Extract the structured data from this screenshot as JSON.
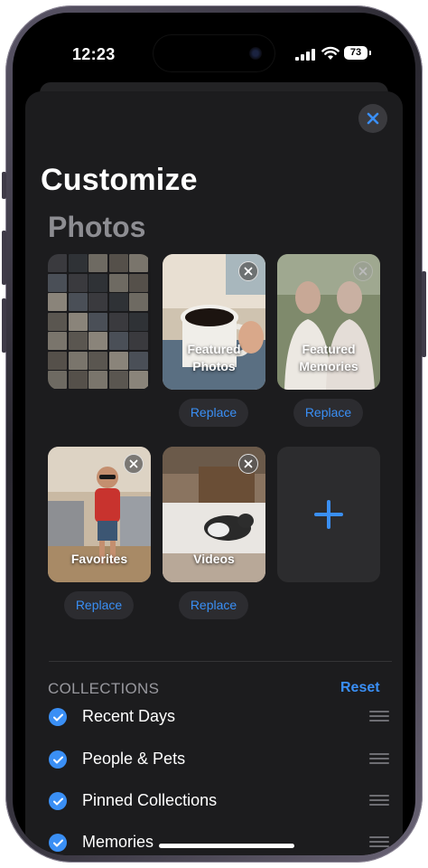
{
  "status_bar": {
    "time": "12:23",
    "battery": "73"
  },
  "sheet": {
    "title": "Customize",
    "subtitle": "Photos"
  },
  "tiles": [
    {
      "label": "",
      "replace_label": "",
      "kind": "library-grid"
    },
    {
      "label": "Featured\nPhotos",
      "replace_label": "Replace",
      "kind": "featured-photos"
    },
    {
      "label": "Featured\nMemories",
      "replace_label": "Replace",
      "kind": "featured-memories"
    },
    {
      "label": "Favorites",
      "replace_label": "Replace",
      "kind": "favorites"
    },
    {
      "label": "Videos",
      "replace_label": "Replace",
      "kind": "videos"
    },
    {
      "label": "",
      "replace_label": "",
      "kind": "add"
    }
  ],
  "collections": {
    "header": "COLLECTIONS",
    "reset_label": "Reset",
    "items": [
      {
        "label": "Recent Days",
        "checked": true
      },
      {
        "label": "People & Pets",
        "checked": true
      },
      {
        "label": "Pinned Collections",
        "checked": true
      },
      {
        "label": "Memories",
        "checked": true
      }
    ]
  },
  "colors": {
    "accent": "#3a8ff5",
    "sheet_bg": "#1c1c1e",
    "secondary_text": "#8d8d92"
  },
  "icons": [
    "close-icon",
    "remove-icon",
    "plus-icon",
    "checkmark-icon",
    "drag-handle-icon",
    "cellular-signal-icon",
    "wifi-icon",
    "battery-icon"
  ]
}
